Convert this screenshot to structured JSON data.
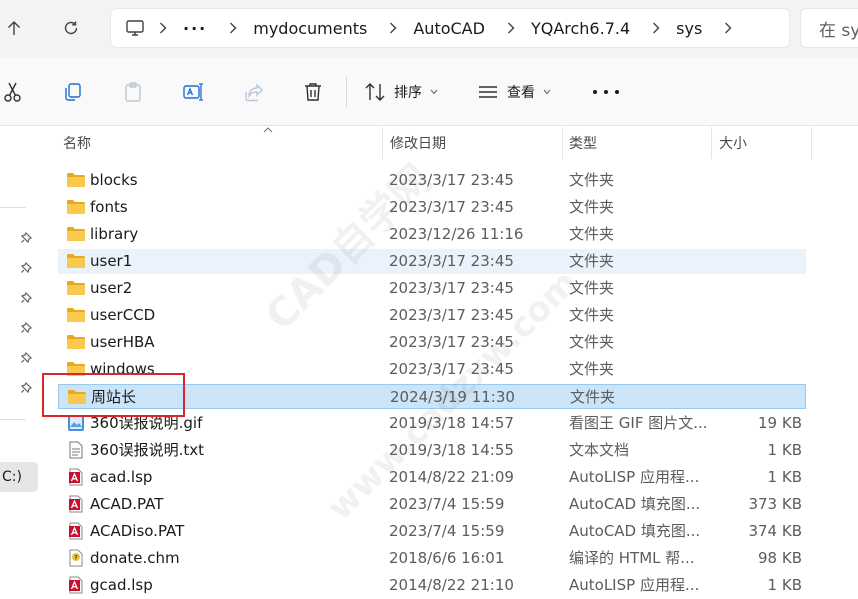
{
  "address": {
    "breadcrumbs": [
      "mydocuments",
      "AutoCAD",
      "YQArch6.7.4",
      "sys"
    ],
    "overflow": "···",
    "search_placeholder": "在 sys"
  },
  "toolbar": {
    "sort_label": "排序",
    "view_label": "查看"
  },
  "nav": {
    "drive_label": "C:)"
  },
  "columns": {
    "name": "名称",
    "date": "修改日期",
    "type": "类型",
    "size": "大小"
  },
  "files": [
    {
      "name": "blocks",
      "date": "2023/3/17 23:45",
      "type": "文件夹",
      "size": "",
      "icon": "folder-icon"
    },
    {
      "name": "fonts",
      "date": "2023/3/17 23:45",
      "type": "文件夹",
      "size": "",
      "icon": "folder-icon"
    },
    {
      "name": "library",
      "date": "2023/12/26 11:16",
      "type": "文件夹",
      "size": "",
      "icon": "folder-icon"
    },
    {
      "name": "user1",
      "date": "2023/3/17 23:45",
      "type": "文件夹",
      "size": "",
      "icon": "folder-icon"
    },
    {
      "name": "user2",
      "date": "2023/3/17 23:45",
      "type": "文件夹",
      "size": "",
      "icon": "folder-icon"
    },
    {
      "name": "userCCD",
      "date": "2023/3/17 23:45",
      "type": "文件夹",
      "size": "",
      "icon": "folder-icon"
    },
    {
      "name": "userHBA",
      "date": "2023/3/17 23:45",
      "type": "文件夹",
      "size": "",
      "icon": "folder-icon"
    },
    {
      "name": "windows",
      "date": "2023/3/17 23:45",
      "type": "文件夹",
      "size": "",
      "icon": "folder-icon"
    },
    {
      "name": "周站长",
      "date": "2024/3/19 11:30",
      "type": "文件夹",
      "size": "",
      "icon": "folder-icon"
    },
    {
      "name": "360误报说明.gif",
      "date": "2019/3/18 14:57",
      "type": "看图王 GIF 图片文...",
      "size": "19 KB",
      "icon": "image-file-icon"
    },
    {
      "name": "360误报说明.txt",
      "date": "2019/3/18 14:55",
      "type": "文本文档",
      "size": "1 KB",
      "icon": "text-file-icon"
    },
    {
      "name": "acad.lsp",
      "date": "2014/8/22 21:09",
      "type": "AutoLISP 应用程...",
      "size": "1 KB",
      "icon": "autocad-file-icon"
    },
    {
      "name": "ACAD.PAT",
      "date": "2023/7/4 15:59",
      "type": "AutoCAD 填充图...",
      "size": "373 KB",
      "icon": "autocad-file-icon"
    },
    {
      "name": "ACADiso.PAT",
      "date": "2023/7/4 15:59",
      "type": "AutoCAD 填充图...",
      "size": "374 KB",
      "icon": "autocad-file-icon"
    },
    {
      "name": "donate.chm",
      "date": "2018/6/6 16:01",
      "type": "编译的 HTML 帮...",
      "size": "98 KB",
      "icon": "chm-file-icon"
    },
    {
      "name": "gcad.lsp",
      "date": "2014/8/22 21:10",
      "type": "AutoLISP 应用程...",
      "size": "1 KB",
      "icon": "autocad-file-icon"
    }
  ],
  "watermark": {
    "line1": "CAD自学网",
    "line2": "www.cadzxw.com"
  },
  "colors": {
    "selection": "#cce4f7",
    "hover": "#eaf3fb",
    "folder": "#f5c04a",
    "annotation_border": "#d9262c",
    "autocad_red": "#c8102e"
  }
}
